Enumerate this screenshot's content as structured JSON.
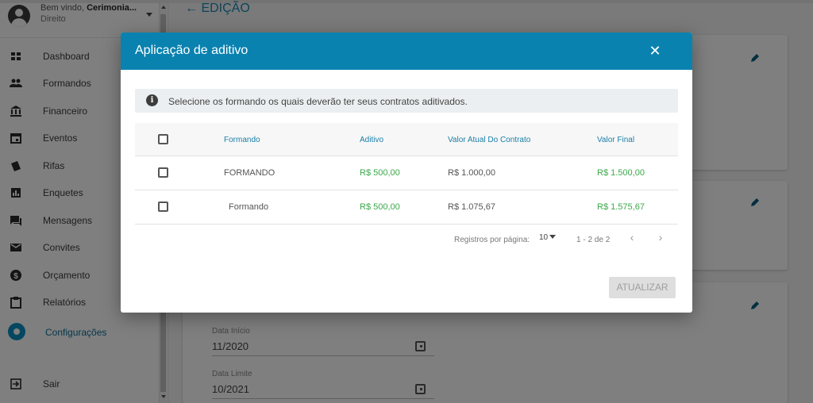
{
  "sidebar": {
    "welcome_prefix": "Bem vindo,",
    "user_name": "Cerimonia...",
    "role": "Direito",
    "items": [
      {
        "label": "Dashboard",
        "icon": "dashboard-icon"
      },
      {
        "label": "Formandos",
        "icon": "people-icon"
      },
      {
        "label": "Financeiro",
        "icon": "bank-icon"
      },
      {
        "label": "Eventos",
        "icon": "calendar-icon"
      },
      {
        "label": "Rifas",
        "icon": "ticket-icon"
      },
      {
        "label": "Enquetes",
        "icon": "poll-icon"
      },
      {
        "label": "Mensagens",
        "icon": "chat-icon"
      },
      {
        "label": "Convites",
        "icon": "mail-icon"
      },
      {
        "label": "Orçamento",
        "icon": "dollar-icon"
      },
      {
        "label": "Relatórios",
        "icon": "clipboard-icon"
      },
      {
        "label": "Configurações",
        "icon": "gear-icon"
      },
      {
        "label": "Sair",
        "icon": "logout-icon"
      }
    ]
  },
  "page": {
    "title": "EDIÇÃO",
    "back_icon": "arrow-left-icon",
    "fields": [
      {
        "label": "Data Início",
        "value": "11/2020"
      },
      {
        "label": "Data Limite",
        "value": "10/2021"
      }
    ]
  },
  "modal": {
    "title": "Aplicação de aditivo",
    "close_icon": "close-icon",
    "info_icon": "i",
    "info_text": "Selecione os formando os quais deverão ter seus contratos aditivados.",
    "columns": [
      "Formando",
      "Aditivo",
      "Valor Atual Do Contrato",
      "Valor Final"
    ],
    "rows": [
      {
        "formando": "FORMANDO",
        "aditivo": "R$ 500,00",
        "valor_atual": "R$ 1.000,00",
        "valor_final": "R$ 1.500,00"
      },
      {
        "formando": "Formando",
        "aditivo": "R$ 500,00",
        "valor_atual": "R$ 1.075,67",
        "valor_final": "R$ 1.575,67"
      }
    ],
    "pagination": {
      "label": "Registros por página:",
      "per_page": "10",
      "range": "1 - 2 de 2",
      "prev": "‹",
      "next": "›"
    },
    "update_button": "ATUALIZAR"
  },
  "colors": {
    "header": "#0a82b0",
    "accent": "#1a88b5",
    "money_green": "#3aa94a"
  }
}
